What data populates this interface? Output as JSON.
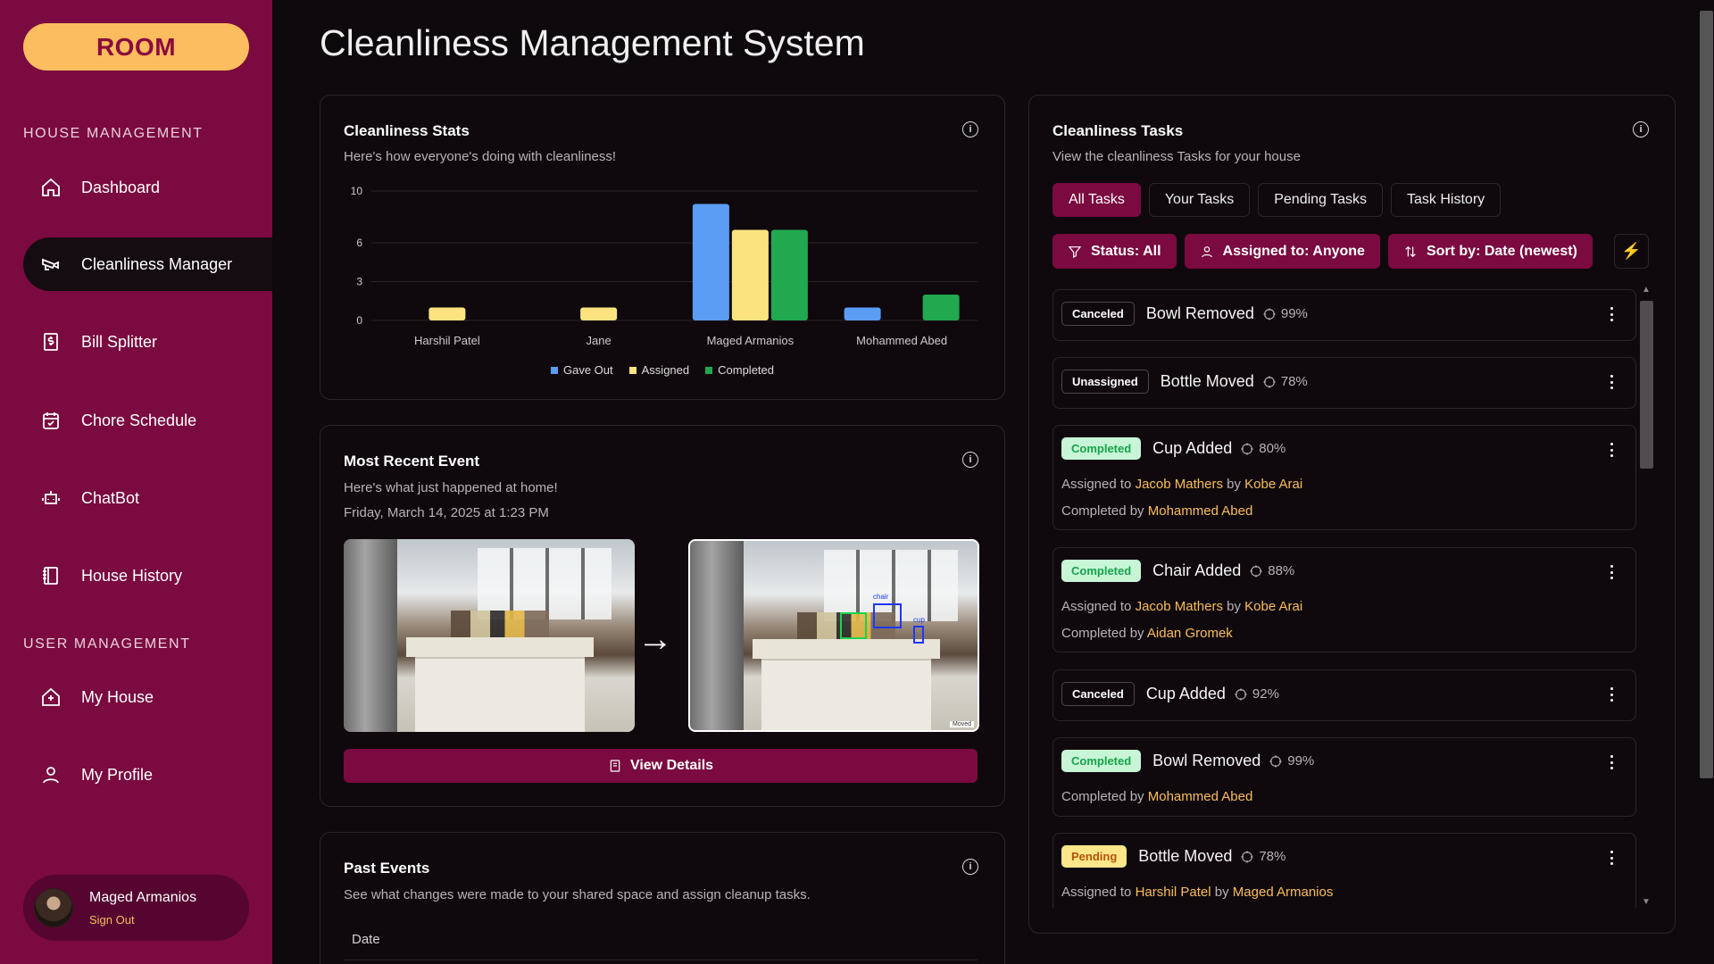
{
  "app": {
    "logo": "ROOM",
    "page_title": "Cleanliness Management System"
  },
  "sidebar": {
    "house_section": "HOUSE MANAGEMENT",
    "user_section": "USER MANAGEMENT",
    "items": [
      {
        "label": "Dashboard",
        "icon": "home-icon"
      },
      {
        "label": "Cleanliness Manager",
        "icon": "camera-icon",
        "active": true
      },
      {
        "label": "Bill Splitter",
        "icon": "receipt-dollar-icon"
      },
      {
        "label": "Chore Schedule",
        "icon": "calendar-check-icon"
      },
      {
        "label": "ChatBot",
        "icon": "bot-icon"
      },
      {
        "label": "House History",
        "icon": "book-icon"
      },
      {
        "label": "My House",
        "icon": "house-plus-icon"
      },
      {
        "label": "My Profile",
        "icon": "user-icon"
      }
    ],
    "user": {
      "name": "Maged Armanios",
      "sign_out": "Sign Out"
    }
  },
  "stats": {
    "title": "Cleanliness Stats",
    "subtitle": "Here's how everyone's doing with cleanliness!"
  },
  "chart_data": {
    "type": "bar",
    "categories": [
      "Harshil Patel",
      "Jane",
      "Maged Armanios",
      "Mohammed Abed"
    ],
    "series": [
      {
        "name": "Gave Out",
        "color": "#5b9cf5",
        "values": [
          0,
          0,
          9,
          1
        ]
      },
      {
        "name": "Assigned",
        "color": "#fbe47f",
        "values": [
          1,
          1,
          7,
          0
        ]
      },
      {
        "name": "Completed",
        "color": "#22a84f",
        "values": [
          0,
          0,
          7,
          2
        ]
      }
    ],
    "y_ticks": [
      "0",
      "3",
      "6",
      "10"
    ],
    "ylim": [
      0,
      10
    ],
    "legend_position": "bottom",
    "grid": true
  },
  "recent": {
    "title": "Most Recent Event",
    "subtitle": "Here's what just happened at home!",
    "timestamp": "Friday, March 14, 2025 at 1:23 PM",
    "button": "View Details",
    "detections": [
      "chair",
      "cup"
    ],
    "moved_label": "Moved"
  },
  "past": {
    "title": "Past Events",
    "subtitle": "See what changes were made to your shared space and assign cleanup tasks.",
    "column_date": "Date"
  },
  "tasks": {
    "title": "Cleanliness Tasks",
    "subtitle": "View the cleanliness Tasks for your house",
    "tabs": [
      "All Tasks",
      "Your Tasks",
      "Pending Tasks",
      "Task History"
    ],
    "filters": {
      "status": "Status: All",
      "assigned": "Assigned to: Anyone",
      "sort": "Sort by: Date (newest)"
    },
    "items": [
      {
        "status": "Canceled",
        "name": "Bowl Removed",
        "confidence": "99%"
      },
      {
        "status": "Unassigned",
        "name": "Bottle Moved",
        "confidence": "78%"
      },
      {
        "status": "Completed",
        "name": "Cup Added",
        "confidence": "80%",
        "assigned_to": "Jacob Mathers",
        "assigned_by": "Kobe Arai",
        "completed_by": "Mohammed Abed"
      },
      {
        "status": "Completed",
        "name": "Chair Added",
        "confidence": "88%",
        "assigned_to": "Jacob Mathers",
        "assigned_by": "Kobe Arai",
        "completed_by": "Aidan Gromek"
      },
      {
        "status": "Canceled",
        "name": "Cup Added",
        "confidence": "92%"
      },
      {
        "status": "Completed",
        "name": "Bowl Removed",
        "confidence": "99%",
        "completed_by": "Mohammed Abed"
      },
      {
        "status": "Pending",
        "name": "Bottle Moved",
        "confidence": "78%",
        "assigned_to": "Harshil Patel",
        "assigned_by": "Maged Armanios"
      }
    ],
    "labels": {
      "assigned_to": "Assigned to",
      "by": "by",
      "completed_by": "Completed by"
    }
  }
}
